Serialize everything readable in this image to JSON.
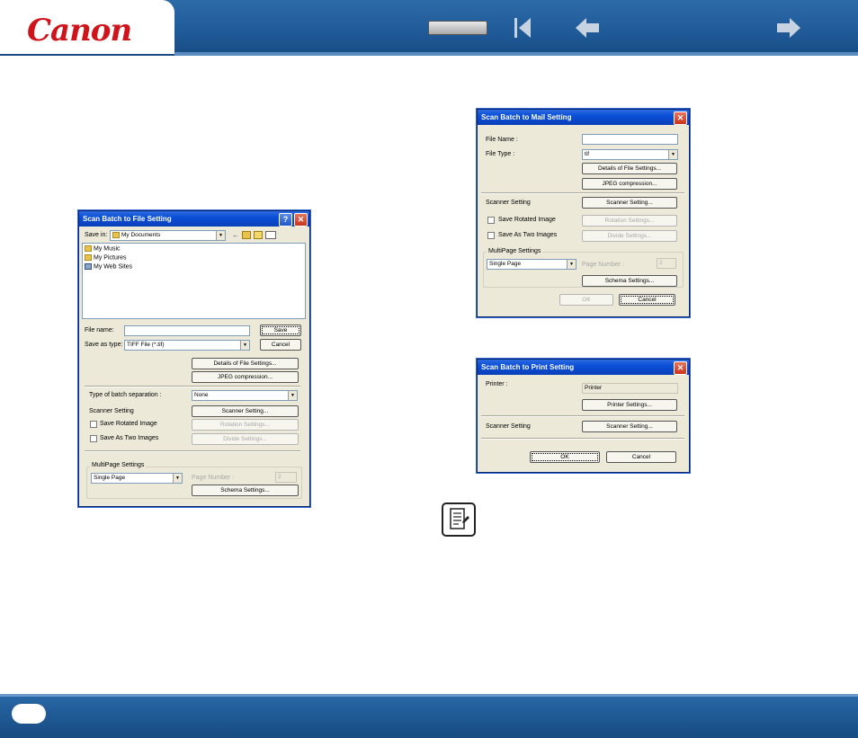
{
  "header": {
    "logo": "Canon"
  },
  "dlg_file": {
    "title": "Scan Batch to File Setting",
    "help": "?",
    "close": "✕",
    "save_in_label": "Save in:",
    "save_in_value": "My Documents",
    "items": [
      "My Music",
      "My Pictures",
      "My Web Sites"
    ],
    "file_name_label": "File name:",
    "file_name_value": "",
    "save_btn": "Save",
    "save_type_label": "Save as type:",
    "save_type_value": "TIFF File (*.tif)",
    "cancel_btn": "Cancel",
    "details_btn": "Details of File Settings...",
    "jpeg_btn": "JPEG compression...",
    "batch_label": "Type of batch separation :",
    "batch_value": "None",
    "scanner_label": "Scanner Setting",
    "scanner_btn": "Scanner Setting...",
    "rotated_label": "Save Rotated Image",
    "rotation_btn": "Rotation Settings...",
    "two_images_label": "Save As Two Images",
    "divide_btn": "Divide Settings...",
    "multipage_label": "MultiPage Settings",
    "multipage_value": "Single Page",
    "page_number_label": "Page Number :",
    "page_number_value": "2",
    "schema_btn": "Schema Settings..."
  },
  "dlg_mail": {
    "title": "Scan Batch to Mail Setting",
    "close": "✕",
    "file_name_label": "File Name :",
    "file_name_value": "",
    "file_type_label": "File Type :",
    "file_type_value": "tif",
    "details_btn": "Details of File Settings...",
    "jpeg_btn": "JPEG compression...",
    "scanner_label": "Scanner Setting",
    "scanner_btn": "Scanner Setting...",
    "rotated_label": "Save Rotated Image",
    "rotation_btn": "Rotation Settings...",
    "two_images_label": "Save As Two Images",
    "divide_btn": "Divide Settings...",
    "multipage_label": "MultiPage Settings",
    "multipage_value": "Single Page",
    "page_number_label": "Page Number :",
    "page_number_value": "2",
    "schema_btn": "Schema Settings...",
    "ok_btn": "OK",
    "cancel_btn": "Cancel"
  },
  "dlg_print": {
    "title": "Scan Batch to Print Setting",
    "close": "✕",
    "printer_label": "Printer :",
    "printer_value": "Printer",
    "printer_btn": "Printer Settings...",
    "scanner_label": "Scanner Setting",
    "scanner_btn": "Scanner Setting...",
    "ok_btn": "OK",
    "cancel_btn": "Cancel"
  },
  "icons": {
    "note": "note-icon"
  }
}
